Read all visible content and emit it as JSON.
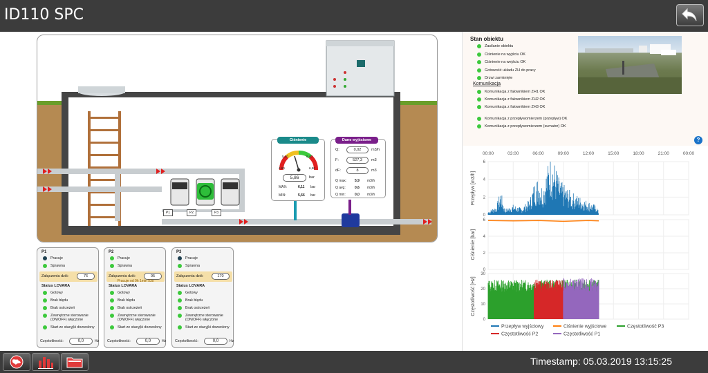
{
  "app_title": "ID110 SPC",
  "timestamp": "Timestamp: 05.03.2019 13:15:25",
  "status": {
    "title": "Stan obiektu",
    "items": [
      {
        "label": "Zasilanie obiektu",
        "ok": true
      },
      {
        "label": "Ciśnienie na wyjściu OK",
        "ok": true
      },
      {
        "label": "Ciśnienie na wejściu OK",
        "ok": true
      },
      {
        "label": "Gotowość układu ZH do pracy",
        "ok": true
      },
      {
        "label": "Drzwi zamknięte",
        "ok": true
      }
    ],
    "komunikacja_title": "Komunikacja",
    "komunikacja": [
      {
        "label": "Komunikacja z falownikiem ZH1 OK",
        "ok": true
      },
      {
        "label": "Komunikacja z falownikiem ZH2 OK",
        "ok": true
      },
      {
        "label": "Komunikacja z falownikiem ZH3 OK",
        "ok": true
      },
      {
        "label": "Komunikacja z przepływomierzem (przepływ) OK",
        "ok": true
      },
      {
        "label": "Komunikacja z przepływomierzem (sumator) OK",
        "ok": true
      }
    ],
    "help": "?"
  },
  "pressure_panel": {
    "title": "Ciśnienie",
    "value": "5,86",
    "unit": "bar",
    "max_label": "MAX:",
    "max": "6,11",
    "min_label": "MIN:",
    "min": "5,66",
    "gauge_min": "4,60",
    "gauge_max": "6,90",
    "gauge_t1": "5,40",
    "gauge_t2": "6,40"
  },
  "output_panel": {
    "title": "Dane wyjściowe",
    "rows": [
      {
        "label": "Q:",
        "value": "0,02",
        "unit": "m3/h"
      },
      {
        "label": "F:",
        "value": "527,3",
        "unit": "m3"
      },
      {
        "label": "dF:",
        "value": "8",
        "unit": "m3"
      }
    ],
    "stats": [
      {
        "label": "Q max:",
        "value": "5,9",
        "unit": "m3/h"
      },
      {
        "label": "Q avg:",
        "value": "0,6",
        "unit": "m3/h"
      },
      {
        "label": "Q min:",
        "value": "0,0",
        "unit": "m3/h"
      }
    ]
  },
  "pump_tags": [
    "P1",
    "P2",
    "P3"
  ],
  "pumps": [
    {
      "name": "P1",
      "pracuje": "Pracuje",
      "pracuje_on": false,
      "sprawna": "Sprawna",
      "zal_label": "Załączenia dziś:",
      "zal_value": "76",
      "note": "",
      "status_title": "Status LOVARA",
      "gotowy": "Gotowy",
      "brak_bledu": "Brak błędu",
      "brak_ostrzezen": "Brak ostrzeżeń",
      "zewn": "Zewnętrzne sterowanie (ON/OFF) włączone",
      "start": "Start ze stacyjki dozwolony",
      "freq_label": "Częstotliwość:",
      "freq_value": "0,0",
      "freq_unit": "Hz"
    },
    {
      "name": "P2",
      "pracuje": "Pracuje",
      "pracuje_on": true,
      "sprawna": "Sprawna",
      "zal_label": "Załączenia dziś:",
      "zal_value": "95",
      "note": "Pracuje od 0h 1min 53s",
      "status_title": "Status LOVARA",
      "gotowy": "Gotowy",
      "brak_bledu": "Brak błędu",
      "brak_ostrzezen": "Brak ostrzeżeń",
      "zewn": "Zewnętrzne sterowanie (ON/OFF) włączone",
      "start": "Start ze stacyjki dozwolony",
      "freq_label": "Częstotliwość:",
      "freq_value": "0,0",
      "freq_unit": "Hz"
    },
    {
      "name": "P3",
      "pracuje": "Pracuje",
      "pracuje_on": false,
      "sprawna": "Sprawna",
      "zal_label": "Załączenia dziś:",
      "zal_value": "170",
      "note": "",
      "status_title": "Status LOVARA",
      "gotowy": "Gotowy",
      "brak_bledu": "Brak błędu",
      "brak_ostrzezen": "Brak ostrzeżeń",
      "zewn": "Zewnętrzne sterowanie (ON/OFF) włączone",
      "start": "Start ze stacyjki dozwolony",
      "freq_label": "Częstotliwość:",
      "freq_value": "0,0",
      "freq_unit": "Hz"
    }
  ],
  "colors": {
    "ok": "#3cc93c",
    "off": "#1f4050",
    "flow": "#1f77b4",
    "pressure": "#ff7f0e",
    "p3": "#2ca02c",
    "p2": "#d62728",
    "p1": "#9467bd"
  },
  "chart_data": {
    "type": "line",
    "x_ticks": [
      "00:00",
      "03:00",
      "06:00",
      "09:00",
      "12:00",
      "15:00",
      "18:00",
      "21:00",
      "00:00"
    ],
    "x_range_hours": [
      0,
      24
    ],
    "data_end_hour": 13.25,
    "panels": [
      {
        "ylabel": "Przepływ [m3/h]",
        "ylim": [
          0,
          6
        ],
        "yticks": [
          0,
          2,
          4,
          6
        ],
        "series": [
          {
            "name": "Przepływ wyjściowy",
            "color": "#1f77b4",
            "points": [
              [
                0,
                0.3
              ],
              [
                1,
                0.8
              ],
              [
                1.5,
                2.2
              ],
              [
                2,
                0.5
              ],
              [
                3,
                0.9
              ],
              [
                4,
                0.6
              ],
              [
                5,
                1.4
              ],
              [
                5.5,
                2.8
              ],
              [
                6,
                3.4
              ],
              [
                6.5,
                2.6
              ],
              [
                7,
                4.0
              ],
              [
                7.5,
                5.6
              ],
              [
                8,
                4.5
              ],
              [
                8.5,
                3.2
              ],
              [
                9,
                2.7
              ],
              [
                10,
                2.0
              ],
              [
                11,
                1.6
              ],
              [
                12,
                1.2
              ],
              [
                13,
                0.8
              ],
              [
                13.25,
                0.2
              ]
            ]
          }
        ]
      },
      {
        "ylabel": "Ciśnienie [bar]",
        "ylim": [
          0,
          6
        ],
        "yticks": [
          0,
          2,
          4,
          6
        ],
        "series": [
          {
            "name": "Ciśnienie wyjściowe",
            "color": "#ff7f0e",
            "points": [
              [
                0,
                5.9
              ],
              [
                3,
                5.85
              ],
              [
                6,
                5.9
              ],
              [
                9,
                5.8
              ],
              [
                12,
                5.9
              ],
              [
                13.25,
                5.86
              ]
            ]
          }
        ]
      },
      {
        "ylabel": "Częstotliwość [Hz]",
        "ylim": [
          0,
          30
        ],
        "yticks": [
          0,
          10,
          20,
          30
        ],
        "series": [
          {
            "name": "Częstotliwość P3",
            "color": "#2ca02c",
            "range": [
              0,
              13.25
            ],
            "level": [
              18,
              26
            ]
          },
          {
            "name": "Częstotliwość P2",
            "color": "#d62728",
            "range": [
              5.5,
              9
            ],
            "level": [
              18,
              26
            ]
          },
          {
            "name": "Częstotliwość P1",
            "color": "#9467bd",
            "range": [
              9,
              13.25
            ],
            "level": [
              18,
              27
            ]
          }
        ]
      }
    ],
    "legend": [
      "Przepływ wyjściowy",
      "Ciśnienie wyjściowe",
      "Częstotliwość P3",
      "Częstotliwość P2",
      "Częstotliwość P1"
    ]
  }
}
